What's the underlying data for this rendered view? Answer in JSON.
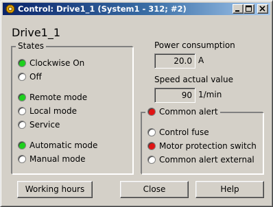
{
  "window": {
    "title": "Control: Drive1_1 (System1 - 312; #2)",
    "controls": [
      "minimize",
      "maximize",
      "close"
    ]
  },
  "heading": "Drive1_1",
  "states": {
    "title": "States",
    "items": [
      {
        "label": "Clockwise On",
        "status": "green"
      },
      {
        "label": "Off",
        "status": "off"
      },
      {
        "label": "Remote mode",
        "status": "green"
      },
      {
        "label": "Local mode",
        "status": "off"
      },
      {
        "label": "Service",
        "status": "off"
      },
      {
        "label": "Automatic mode",
        "status": "green"
      },
      {
        "label": "Manual mode",
        "status": "off"
      }
    ]
  },
  "power": {
    "label": "Power consumption",
    "value": "20.0",
    "unit": "A"
  },
  "speed": {
    "label": "Speed actual value",
    "value": "90",
    "unit": "1/min"
  },
  "alert": {
    "title": "Common alert",
    "title_status": "red",
    "items": [
      {
        "label": "Control fuse",
        "status": "off"
      },
      {
        "label": "Motor protection switch",
        "status": "red"
      },
      {
        "label": "Common alert external",
        "status": "off"
      }
    ]
  },
  "buttons": {
    "working_hours": "Working hours",
    "close": "Close",
    "help": "Help"
  },
  "colors": {
    "green": "#1ed01e",
    "red": "#e01414",
    "face": "#d4d0c8",
    "title_start": "#0a246a",
    "title_end": "#a6caf0"
  }
}
